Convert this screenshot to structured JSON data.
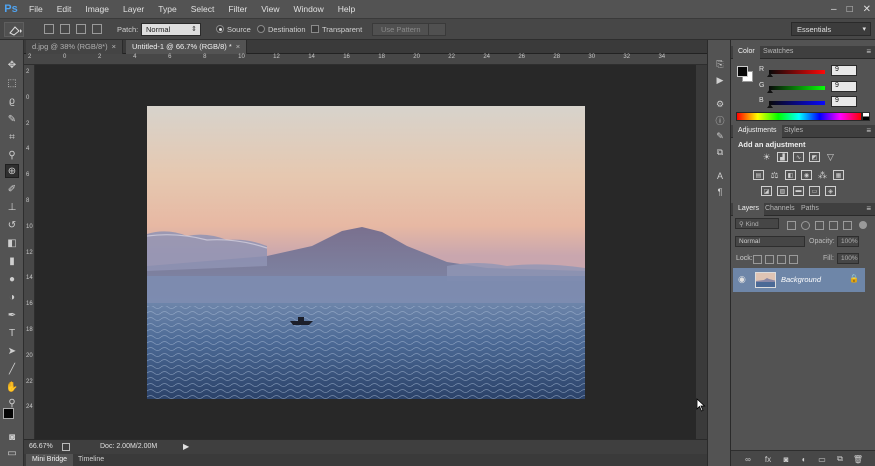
{
  "app": {
    "logo": "Ps"
  },
  "menu": [
    "File",
    "Edit",
    "Image",
    "Layer",
    "Type",
    "Select",
    "Filter",
    "View",
    "Window",
    "Help"
  ],
  "window_controls": {
    "minimize": "–",
    "maximize": "□",
    "close": "✕"
  },
  "options_bar": {
    "patch_label": "Patch:",
    "patch_mode": "Normal",
    "source_label": "Source",
    "destination_label": "Destination",
    "transparent_label": "Transparent",
    "use_pattern_label": "Use Pattern",
    "workspace": "Essentials"
  },
  "tabs": [
    {
      "title": "d.jpg @ 38% (RGB/8*)",
      "close": "×"
    },
    {
      "title": "Untitled-1 @ 66.7% (RGB/8) *",
      "close": "×"
    }
  ],
  "ruler_top": [
    "2",
    "0",
    "2",
    "4",
    "6",
    "8",
    "10",
    "12",
    "14",
    "16",
    "18",
    "20",
    "22",
    "24",
    "26",
    "28",
    "30",
    "32",
    "34"
  ],
  "ruler_left": [
    "2",
    "0",
    "2",
    "4",
    "6",
    "8",
    "10",
    "12",
    "14",
    "16",
    "18",
    "20",
    "22",
    "24"
  ],
  "status": {
    "zoom": "66.67%",
    "doc": "Doc: 2.00M/2.00M"
  },
  "bottom_tabs": [
    "Mini Bridge",
    "Timeline"
  ],
  "color_panel": {
    "tabs": [
      "Color",
      "Swatches"
    ],
    "rows": [
      {
        "label": "R",
        "value": "9"
      },
      {
        "label": "G",
        "value": "9"
      },
      {
        "label": "B",
        "value": "9"
      }
    ]
  },
  "adjustments_panel": {
    "tabs": [
      "Adjustments",
      "Styles"
    ],
    "heading": "Add an adjustment"
  },
  "layers_panel": {
    "tabs": [
      "Layers",
      "Channels",
      "Paths"
    ],
    "kind_label": "Kind",
    "blend_mode": "Normal",
    "opacity_label": "Opacity:",
    "opacity_value": "100%",
    "lock_label": "Lock:",
    "fill_label": "Fill:",
    "fill_value": "100%",
    "layer_name": "Background"
  },
  "colors": {
    "ui_bg": "#535353",
    "canvas_bg": "#282828",
    "layer_selected": "#6e86a8",
    "accent": "#4fa3f0"
  }
}
